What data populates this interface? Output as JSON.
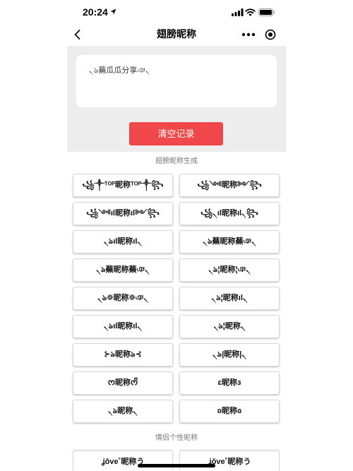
{
  "status_bar": {
    "time": "20:24",
    "icons": [
      "location-arrow-icon",
      "signal-icon",
      "wifi-icon",
      "battery-icon"
    ]
  },
  "nav": {
    "title": "翅膀昵称",
    "back_icon": "chevron-left-icon",
    "more_icon": "more-dots-icon",
    "close_icon": "target-circle-icon"
  },
  "editor": {
    "value": "৲ঌ蕪瓜瓜分享ঞ৲"
  },
  "clear_button": {
    "label": "清空记录"
  },
  "sections": [
    {
      "title": "翅膀昵称生成",
      "items": [
        "꧁༒ᵀᴼᴾ昵称ᵀᴼᴾ༒꧂",
        "꧁༺昵称༻꧂",
        "꧁༺ıl昵称ıl༻꧂",
        "꧁৲ıl昵称ıl৲꧂",
        "৲ঌıl昵称ıl৲",
        "৲ঌ蕪昵称蕪ঞ৲",
        "৲ঌ蕪昵称蕪ঞ৲",
        "৲ঌ¦昵称¦ঞ৲",
        "৲ঌ❁昵称❁ঞ৲",
        "৲ঌ¦昵称ıl৲",
        "৲ঌıl昵称ıl৲",
        "৲ঌ¦昵称৲",
        "⊱ঌ昵称ঌ⊰",
        "৲ঌ|昵称|৲",
        "ᰔ昵称ᰔᩚ",
        "ɛ昵称ɜ",
        "৲ঌ昵称৲",
        "ʚ昵称ɞ"
      ]
    },
    {
      "title": "情侣个性昵称",
      "items": [
        "ʝǒve˚昵称う",
        "ʝǒve˚昵称う"
      ]
    }
  ],
  "colors": {
    "accent": "#f0474a",
    "panel_background": "#ededed",
    "section_title": "#7a7a7a"
  }
}
